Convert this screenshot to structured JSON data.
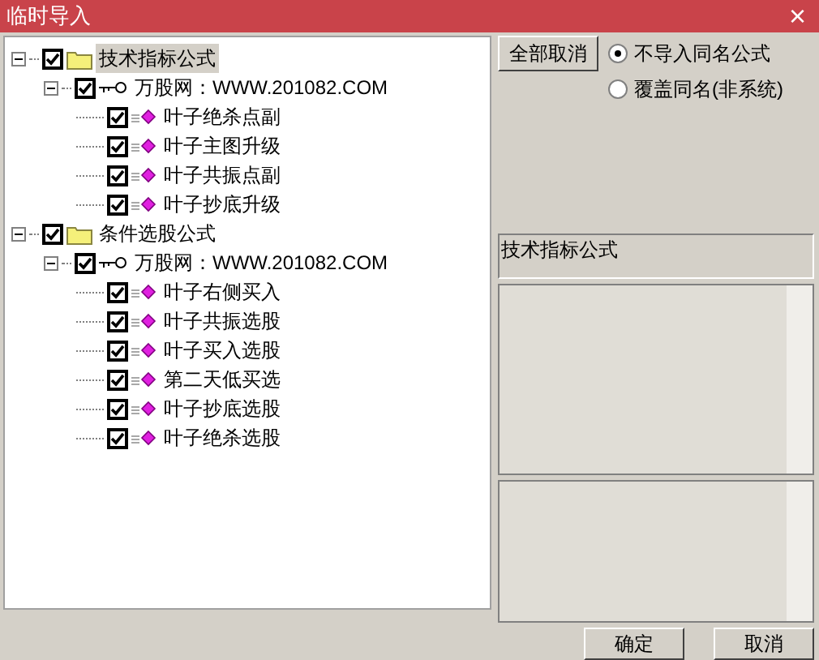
{
  "window": {
    "title": "临时导入",
    "close": "×"
  },
  "tree": [
    {
      "kind": "folder",
      "label": "技术指标公式",
      "checked": true,
      "expanded": true,
      "selected": true,
      "children": [
        {
          "kind": "group",
          "label": "万股网：WWW.201082.COM",
          "checked": true,
          "expanded": true,
          "selected": false,
          "children": [
            {
              "kind": "formula",
              "label": "叶子绝杀点副",
              "checked": true,
              "selected": false
            },
            {
              "kind": "formula",
              "label": "叶子主图升级",
              "checked": true,
              "selected": false
            },
            {
              "kind": "formula",
              "label": "叶子共振点副",
              "checked": true,
              "selected": false
            },
            {
              "kind": "formula",
              "label": "叶子抄底升级",
              "checked": true,
              "selected": false
            }
          ]
        }
      ]
    },
    {
      "kind": "folder",
      "label": "条件选股公式",
      "checked": true,
      "expanded": true,
      "selected": false,
      "children": [
        {
          "kind": "group",
          "label": "万股网：WWW.201082.COM",
          "checked": true,
          "expanded": true,
          "selected": false,
          "children": [
            {
              "kind": "formula",
              "label": "叶子右侧买入",
              "checked": true,
              "selected": false
            },
            {
              "kind": "formula",
              "label": "叶子共振选股",
              "checked": true,
              "selected": false
            },
            {
              "kind": "formula",
              "label": "叶子买入选股",
              "checked": true,
              "selected": false
            },
            {
              "kind": "formula",
              "label": "第二天低买选",
              "checked": true,
              "selected": false
            },
            {
              "kind": "formula",
              "label": "叶子抄底选股",
              "checked": true,
              "selected": false
            },
            {
              "kind": "formula",
              "label": "叶子绝杀选股",
              "checked": true,
              "selected": false
            }
          ]
        }
      ]
    }
  ],
  "deselect_all_button": "全部取消",
  "options": [
    {
      "label": "不导入同名公式",
      "selected": true
    },
    {
      "label": "覆盖同名(非系统)",
      "selected": false
    }
  ],
  "category_field": {
    "value": "技术指标公式"
  },
  "buttons": [
    "确定",
    "取消"
  ]
}
